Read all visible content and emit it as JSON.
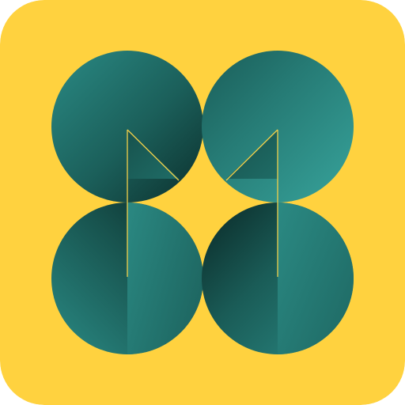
{
  "app_icon": {
    "icon_name": "app-logo-icon",
    "motif": "four-circles-m-monogram",
    "colors": {
      "background": "#FFD23F",
      "teal_light": "#2E9790",
      "teal_mid": "#1F6E68",
      "teal_dark": "#0A2A28",
      "fold_line": "#F2D04A"
    }
  }
}
